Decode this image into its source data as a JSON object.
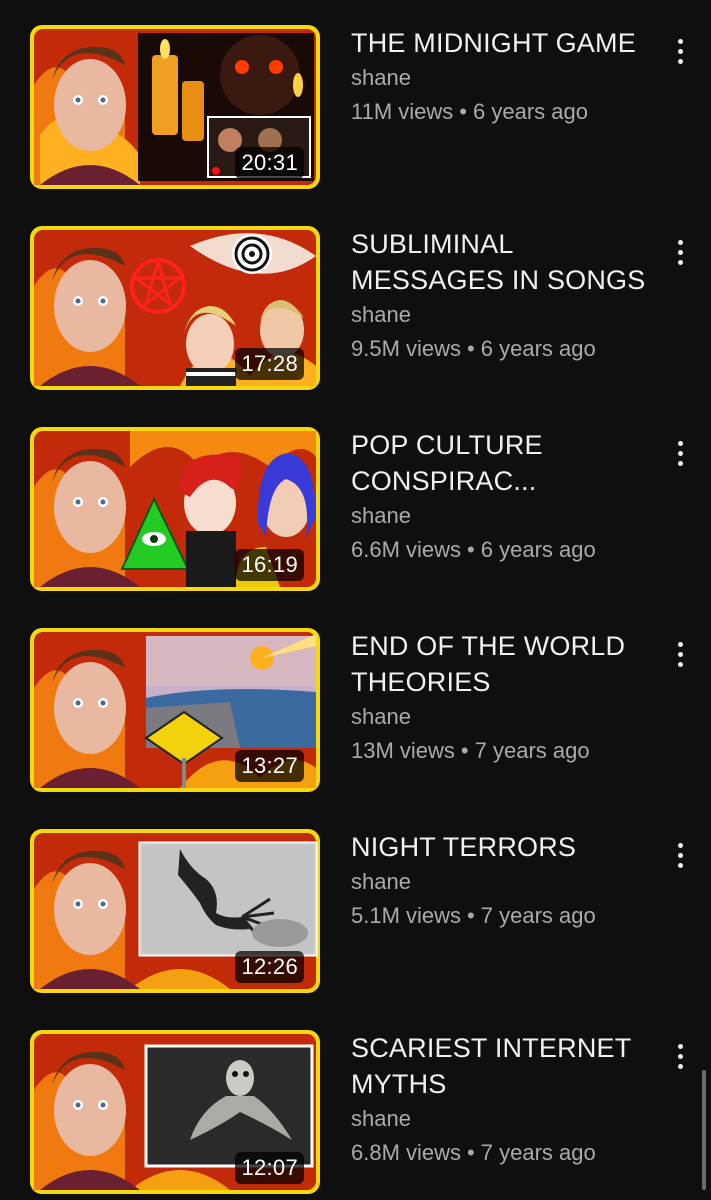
{
  "colors": {
    "background": "#0f0f0f",
    "title_text": "#f1f1f1",
    "secondary_text": "#aaaaaa",
    "thumbnail_border": "#f5d90a"
  },
  "icons": {
    "menu": "more-vert-icon"
  },
  "videos": [
    {
      "title": "THE MIDNIGHT GAME",
      "channel": "shane",
      "views": "11M views",
      "age": "6 years ago",
      "duration": "20:31"
    },
    {
      "title": "SUBLIMINAL MESSAGES IN SONGS",
      "channel": "shane",
      "views": "9.5M views",
      "age": "6 years ago",
      "duration": "17:28"
    },
    {
      "title": "POP CULTURE CONSPIRAC...",
      "channel": "shane",
      "views": "6.6M views",
      "age": "6 years ago",
      "duration": "16:19"
    },
    {
      "title": "END OF THE WORLD THEORIES",
      "channel": "shane",
      "views": "13M views",
      "age": "7 years ago",
      "duration": "13:27"
    },
    {
      "title": "NIGHT TERRORS",
      "channel": "shane",
      "views": "5.1M views",
      "age": "7 years ago",
      "duration": "12:26"
    },
    {
      "title": "SCARIEST INTERNET MYTHS",
      "channel": "shane",
      "views": "6.8M views",
      "age": "7 years ago",
      "duration": "12:07"
    }
  ]
}
